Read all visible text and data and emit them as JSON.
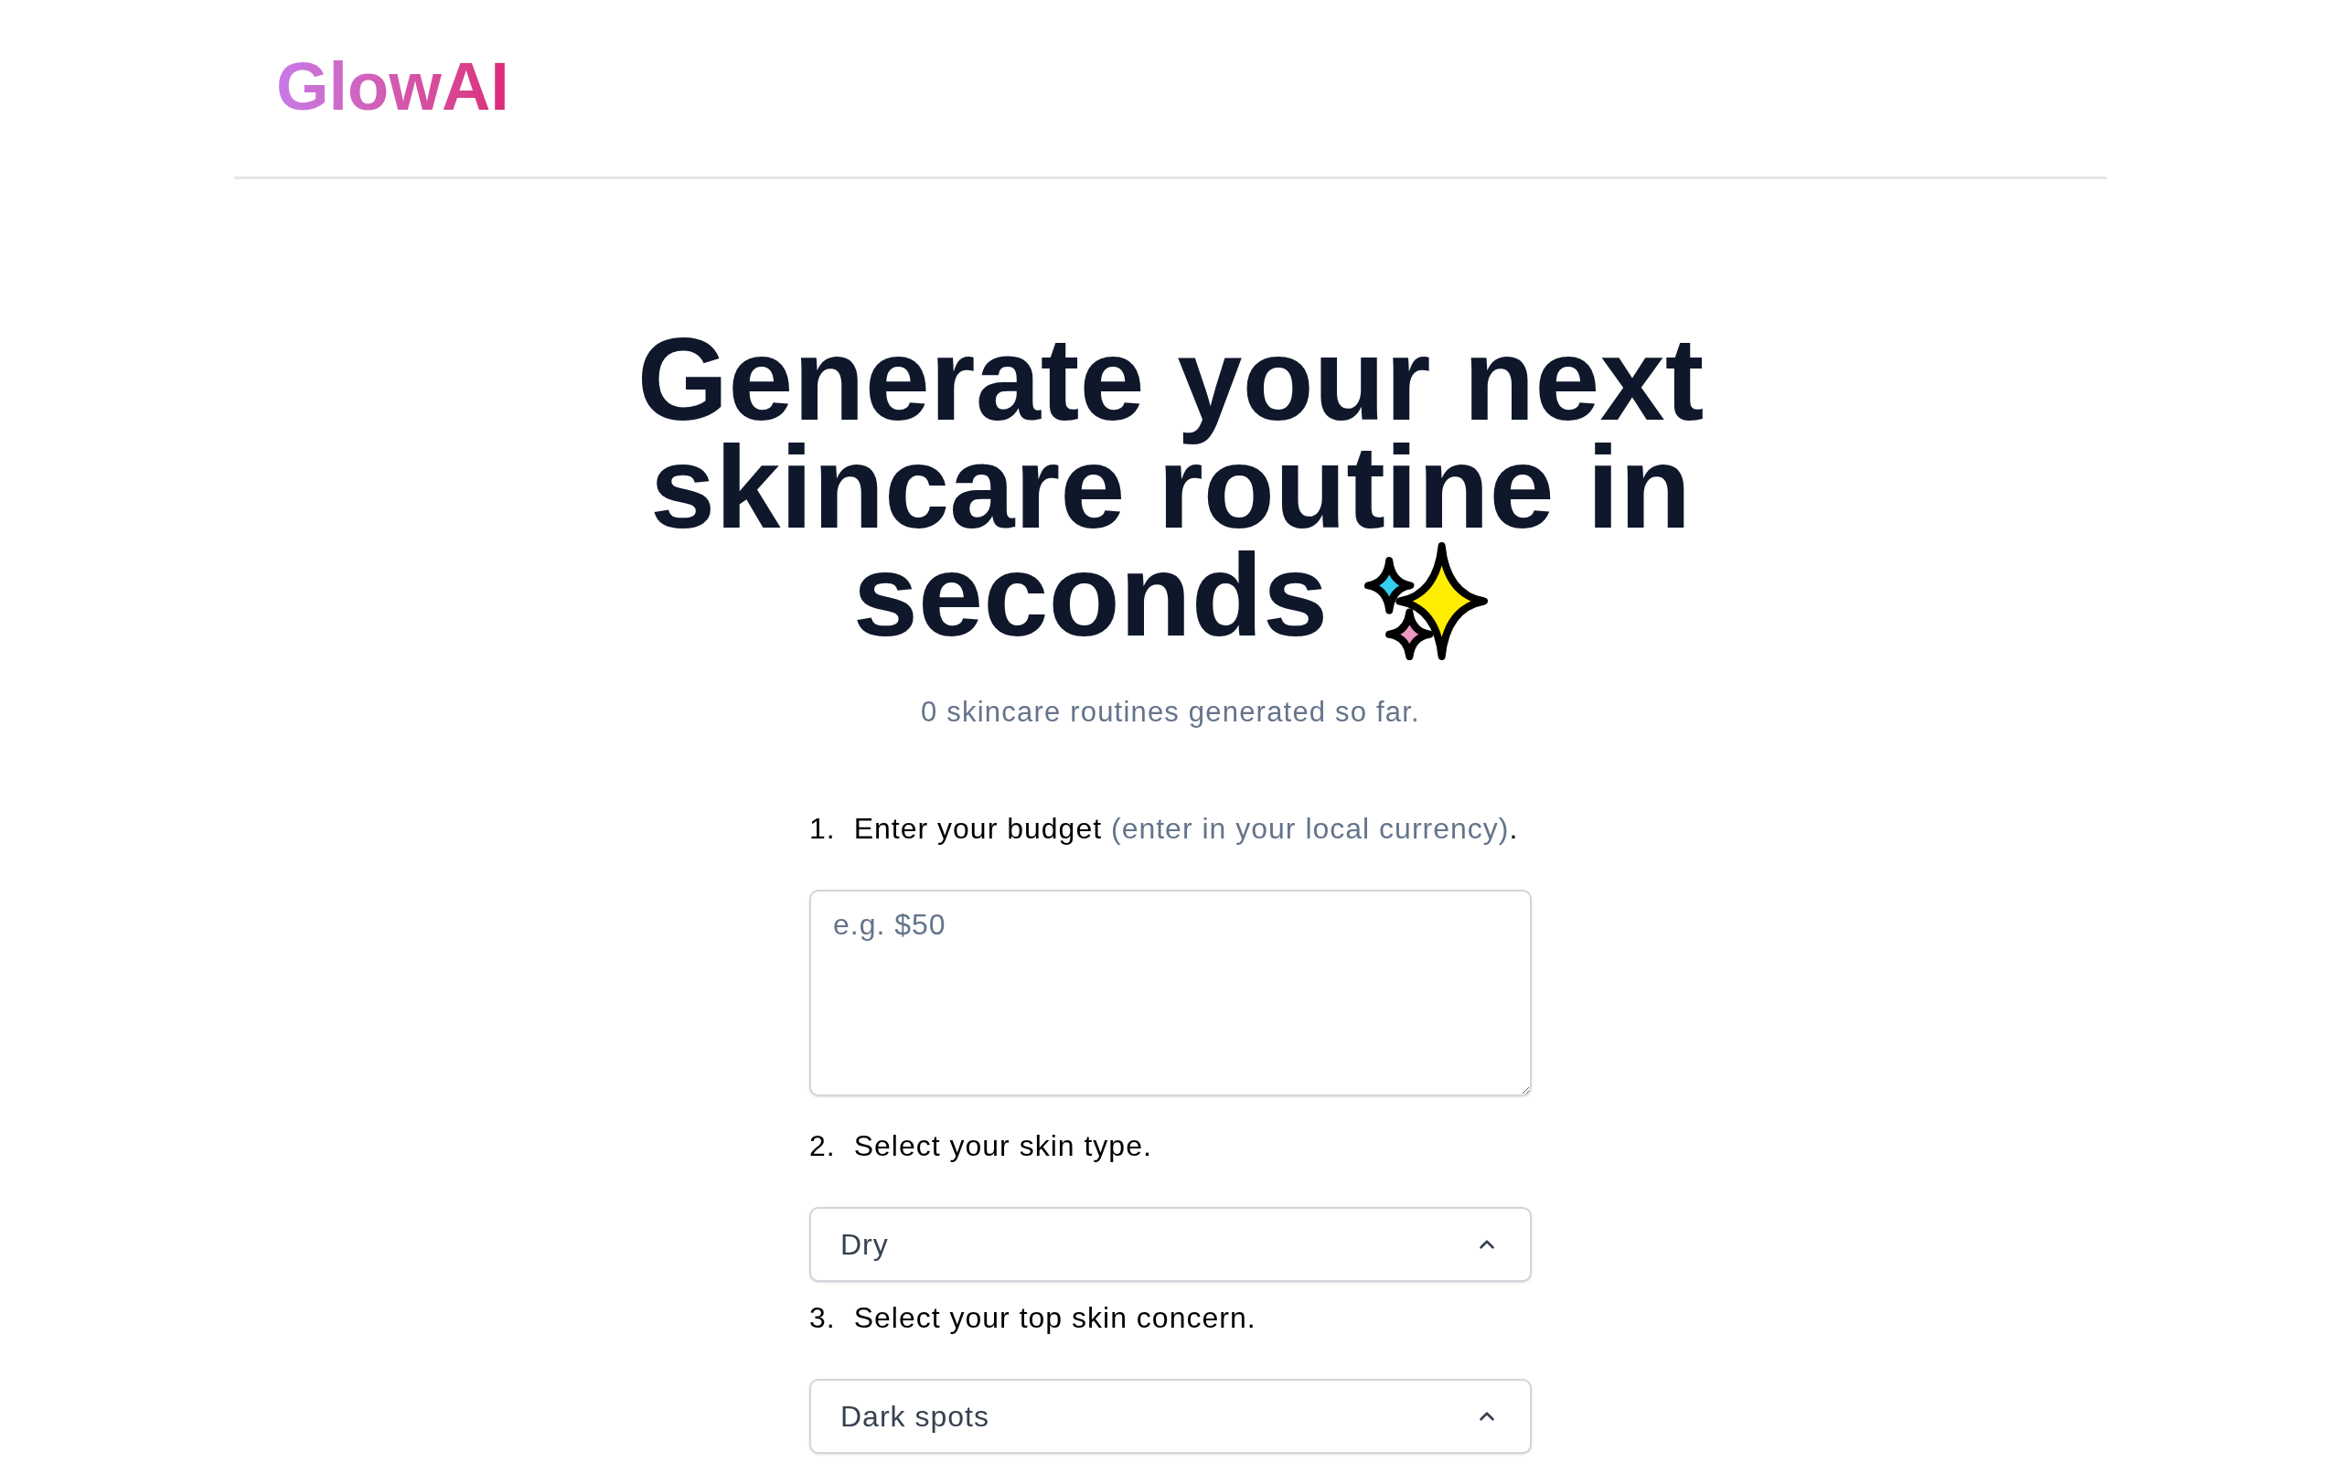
{
  "header": {
    "logo": "GlowAI"
  },
  "hero": {
    "title_lines": [
      "Generate your next",
      "skincare routine in",
      "seconds"
    ],
    "subtitle": "0 skincare routines generated so far."
  },
  "form": {
    "steps": [
      {
        "kind": "textarea",
        "number": "1.",
        "label": "Enter your budget",
        "hint": "(enter in your local currency)",
        "suffix": ".",
        "placeholder": "e.g. $50"
      },
      {
        "kind": "select",
        "number": "2.",
        "label": "Select your skin type.",
        "value": "Dry"
      },
      {
        "kind": "select",
        "number": "3.",
        "label": "Select your top skin concern.",
        "value": "Dark spots"
      }
    ]
  }
}
